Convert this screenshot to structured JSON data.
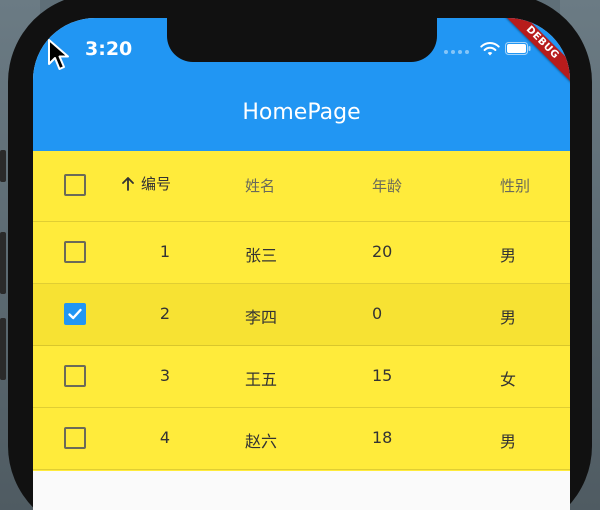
{
  "status_bar": {
    "time": "3:20",
    "wifi_icon": "wifi-icon",
    "battery_icon": "battery-icon"
  },
  "debug_banner": "DEBUG",
  "app_bar": {
    "title": "HomePage",
    "color": "#2196f3"
  },
  "table": {
    "background": "#ffeb3b",
    "columns": {
      "id": "编号",
      "name": "姓名",
      "age": "年龄",
      "sex": "性别"
    },
    "sort": {
      "column": "id",
      "direction": "ascending",
      "icon": "arrow-up-icon"
    },
    "select_all_checked": false,
    "rows": [
      {
        "id": "1",
        "name": "张三",
        "age": "20",
        "sex": "男",
        "selected": false
      },
      {
        "id": "2",
        "name": "李四",
        "age": "0",
        "sex": "男",
        "selected": true
      },
      {
        "id": "3",
        "name": "王五",
        "age": "15",
        "sex": "女",
        "selected": false
      },
      {
        "id": "4",
        "name": "赵六",
        "age": "18",
        "sex": "男",
        "selected": false
      }
    ]
  }
}
